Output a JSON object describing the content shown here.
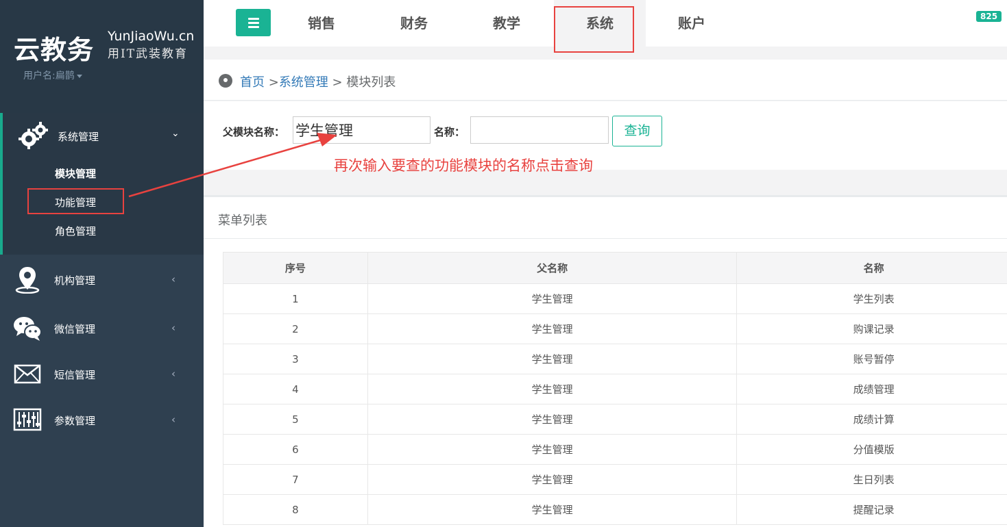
{
  "brand": {
    "name_cn": "云教务",
    "name_en": "YunJiaoWu.cn",
    "slogan": "用IT武装教育"
  },
  "user": {
    "label": "用户名:扁鹊"
  },
  "sidebar": {
    "active_group": {
      "label": "系统管理",
      "items": [
        {
          "label": "模块管理"
        },
        {
          "label": "功能管理"
        },
        {
          "label": "角色管理"
        }
      ]
    },
    "groups": [
      {
        "label": "机构管理",
        "icon": "location-pin-icon"
      },
      {
        "label": "微信管理",
        "icon": "wechat-icon"
      },
      {
        "label": "短信管理",
        "icon": "envelope-icon"
      },
      {
        "label": "参数管理",
        "icon": "sliders-icon"
      }
    ]
  },
  "topnav": {
    "items": [
      "销售",
      "财务",
      "教学",
      "系统",
      "账户"
    ],
    "active": "系统",
    "badge": "825"
  },
  "breadcrumb": {
    "home": "首页",
    "sep1": " >",
    "section": "系统管理",
    "sep2": " > ",
    "current": "模块列表"
  },
  "search": {
    "parent_label": "父模块名称：",
    "parent_value": "学生管理",
    "name_label": "名称：",
    "name_value": "",
    "button": "查询"
  },
  "annotation": "再次输入要查的功能模块的名称点击查询",
  "panel": {
    "title": "菜单列表",
    "columns": [
      "序号",
      "父名称",
      "名称"
    ],
    "rows": [
      [
        "1",
        "学生管理",
        "学生列表"
      ],
      [
        "2",
        "学生管理",
        "购课记录"
      ],
      [
        "3",
        "学生管理",
        "账号暂停"
      ],
      [
        "4",
        "学生管理",
        "成绩管理"
      ],
      [
        "5",
        "学生管理",
        "成绩计算"
      ],
      [
        "6",
        "学生管理",
        "分值模版"
      ],
      [
        "7",
        "学生管理",
        "生日列表"
      ],
      [
        "8",
        "学生管理",
        "提醒记录"
      ]
    ]
  },
  "colors": {
    "sidebar_bg": "#2f4050",
    "accent": "#1ab394",
    "annotation": "#e8423f"
  }
}
